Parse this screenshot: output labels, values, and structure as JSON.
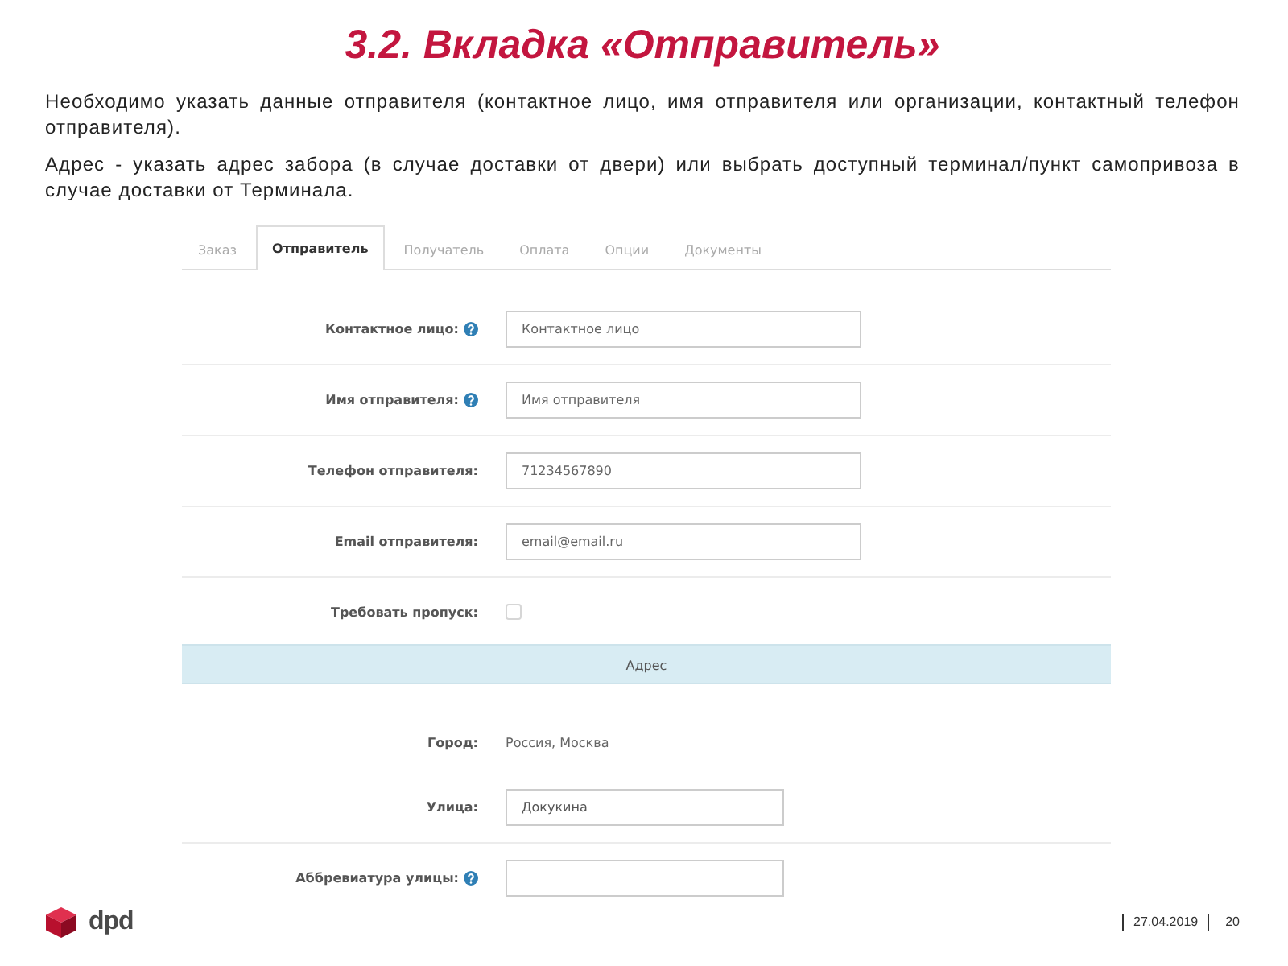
{
  "slide": {
    "title": "3.2. Вкладка «Отправитель»",
    "paragraphs": [
      "Необходимо указать данные отправителя (контактное лицо, имя отправителя или организации, контактный телефон отправителя).",
      "Адрес - указать адрес забора (в случае доставки от двери) или выбрать доступный терминал/пункт самопривоза в случае доставки от Терминала."
    ]
  },
  "form": {
    "tabs": [
      {
        "label": "Заказ",
        "selected": false
      },
      {
        "label": "Отправитель",
        "selected": true
      },
      {
        "label": "Получатель",
        "selected": false
      },
      {
        "label": "Оплата",
        "selected": false
      },
      {
        "label": "Опции",
        "selected": false
      },
      {
        "label": "Документы",
        "selected": false
      }
    ],
    "sender_rows": [
      {
        "kind": "input",
        "label": "Контактное лицо:",
        "help": true,
        "placeholder": "Контактное лицо"
      },
      {
        "kind": "input",
        "label": "Имя отправителя:",
        "help": true,
        "placeholder": "Имя отправителя"
      },
      {
        "kind": "input",
        "label": "Телефон отправителя:",
        "help": false,
        "placeholder": "71234567890"
      },
      {
        "kind": "input",
        "label": "Email отправителя:",
        "help": false,
        "placeholder": "email@email.ru"
      },
      {
        "kind": "checkbox",
        "label": "Требовать пропуск:",
        "help": false,
        "checked": false
      }
    ],
    "address": {
      "heading": "Адрес",
      "rows": [
        {
          "kind": "text",
          "label": "Город:",
          "help": false,
          "value": "Россия, Москва"
        },
        {
          "kind": "input",
          "label": "Улица:",
          "help": false,
          "value": "Докукина"
        },
        {
          "kind": "input",
          "label": "Аббревиатура улицы:",
          "help": true
        }
      ]
    }
  },
  "footer": {
    "logo_text": "dpd",
    "date": "27.04.2019",
    "page": "20"
  }
}
